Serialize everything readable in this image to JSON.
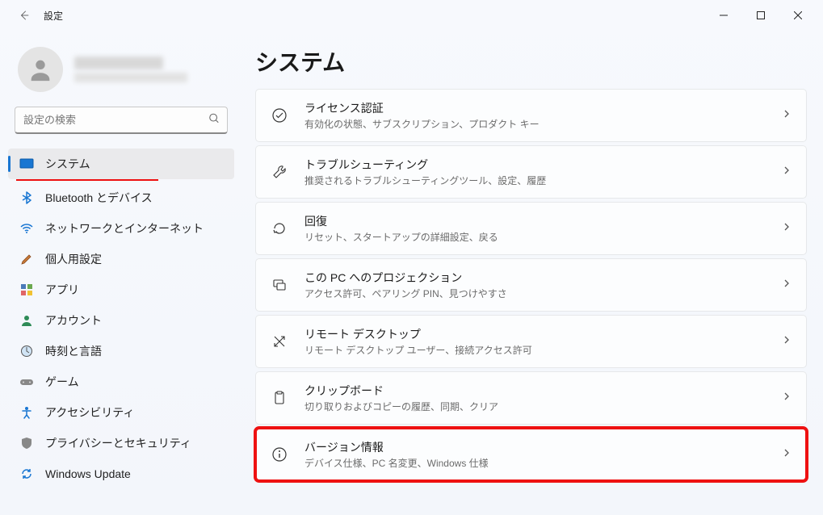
{
  "titlebar": {
    "title": "設定"
  },
  "search": {
    "placeholder": "設定の検索"
  },
  "nav": {
    "items": [
      {
        "label": "システム"
      },
      {
        "label": "Bluetooth とデバイス"
      },
      {
        "label": "ネットワークとインターネット"
      },
      {
        "label": "個人用設定"
      },
      {
        "label": "アプリ"
      },
      {
        "label": "アカウント"
      },
      {
        "label": "時刻と言語"
      },
      {
        "label": "ゲーム"
      },
      {
        "label": "アクセシビリティ"
      },
      {
        "label": "プライバシーとセキュリティ"
      },
      {
        "label": "Windows Update"
      }
    ]
  },
  "main": {
    "title": "システム",
    "cards": [
      {
        "title": "ライセンス認証",
        "sub": "有効化の状態、サブスクリプション、プロダクト キー"
      },
      {
        "title": "トラブルシューティング",
        "sub": "推奨されるトラブルシューティングツール、設定、履歴"
      },
      {
        "title": "回復",
        "sub": "リセット、スタートアップの詳細設定、戻る"
      },
      {
        "title": "この PC へのプロジェクション",
        "sub": "アクセス許可、ペアリング PIN、見つけやすさ"
      },
      {
        "title": "リモート デスクトップ",
        "sub": "リモート デスクトップ ユーザー、接続アクセス許可"
      },
      {
        "title": "クリップボード",
        "sub": "切り取りおよびコピーの履歴、同期、クリア"
      },
      {
        "title": "バージョン情報",
        "sub": "デバイス仕様、PC 名変更、Windows 仕様"
      }
    ]
  }
}
